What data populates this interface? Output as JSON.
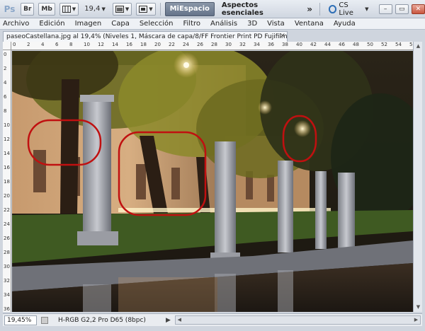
{
  "appbar": {
    "logo": "Ps",
    "bridge": "Br",
    "minibridge": "Mb",
    "zoom": "19,4",
    "active_workspace": "MiEspacio",
    "workspace_alt": "Aspectos esenciales",
    "more": "»",
    "cslive": "CS Live",
    "minimize": "–",
    "restore": "▭",
    "close": "✕"
  },
  "menu": [
    "Archivo",
    "Edición",
    "Imagen",
    "Capa",
    "Selección",
    "Filtro",
    "Análisis",
    "3D",
    "Vista",
    "Ventana",
    "Ayuda"
  ],
  "document": {
    "tab_title": "paseoCastellana.jpg al 19,4% (Niveles 1, Máscara de capa/8/FF Frontier Print PD  Fujifilm, Ver1.0) *",
    "close": "×"
  },
  "ruler": {
    "top": [
      "0",
      "2",
      "4",
      "6",
      "8",
      "10",
      "12",
      "14",
      "16",
      "18",
      "20",
      "22",
      "24",
      "26",
      "28",
      "30",
      "32",
      "34",
      "36",
      "38",
      "40",
      "42",
      "44",
      "46",
      "48",
      "50",
      "52",
      "54",
      "56"
    ],
    "left": [
      "0",
      "2",
      "4",
      "6",
      "8",
      "10",
      "12",
      "14",
      "16",
      "18",
      "20",
      "22",
      "24",
      "26",
      "28",
      "30",
      "32",
      "34",
      "36"
    ]
  },
  "statusbar": {
    "zoom": "19,45%",
    "profile": "H-RGB G2,2 Pro D65 (8bpc)",
    "arrow": "▶"
  },
  "colors": {
    "annotation_circle": "#c01010",
    "active_workspace_bg": "#6f7d92"
  },
  "icons": {
    "cslive": "cs-live-icon",
    "zoom": "zoom-icon",
    "view": "view-extras-icon",
    "arrange": "arrange-documents-icon",
    "screen": "screen-mode-icon"
  }
}
